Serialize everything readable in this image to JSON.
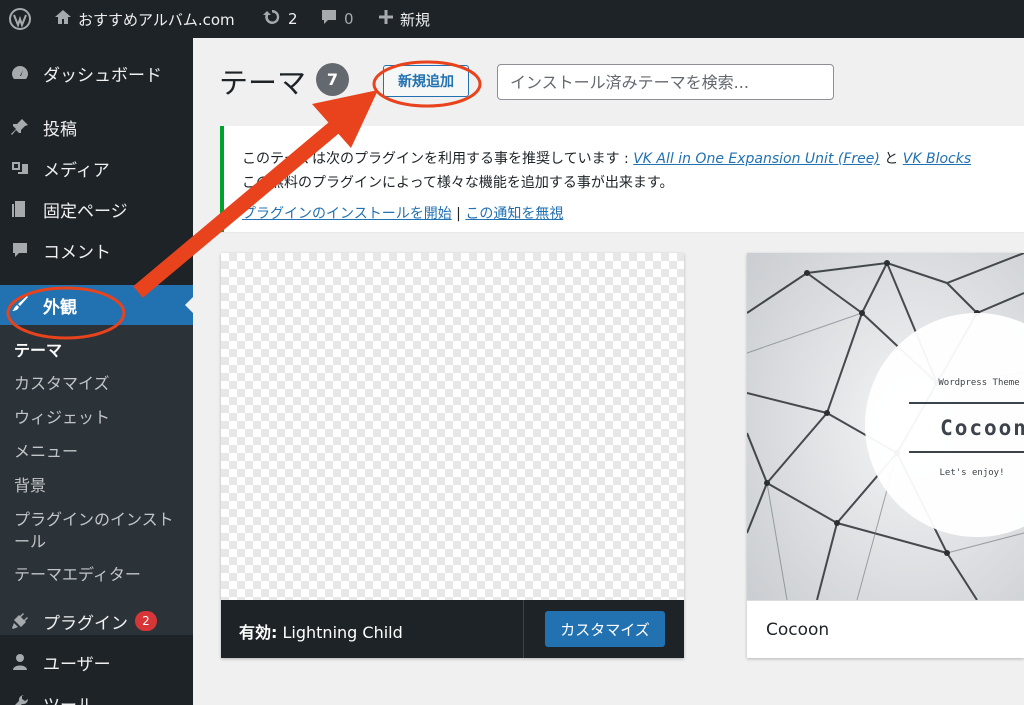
{
  "adminbar": {
    "site_name": "おすすめアルバム.com",
    "updates_count": "2",
    "comments_count": "0",
    "new_label": "新規"
  },
  "sidebar": {
    "dashboard": "ダッシュボード",
    "posts": "投稿",
    "media": "メディア",
    "pages": "固定ページ",
    "comments": "コメント",
    "appearance": "外観",
    "submenu": [
      "テーマ",
      "カスタマイズ",
      "ウィジェット",
      "メニュー",
      "背景",
      "プラグインのインストール",
      "テーマエディター"
    ],
    "plugins": "プラグイン",
    "plugins_badge": "2",
    "users": "ユーザー",
    "tools": "ツール"
  },
  "main": {
    "title": "テーマ",
    "count": "7",
    "add_new": "新規追加",
    "search_placeholder": "インストール済みテーマを検索..."
  },
  "notice": {
    "line1_prefix": "このテーマは次のプラグインを利用する事を推奨しています : ",
    "link_vk_exunit": "VK All in One Expansion Unit (Free)",
    "and": " と ",
    "link_vk_blocks": "VK Blocks",
    "line2": "この無料のプラグインによって様々な機能を追加する事が出来ます。",
    "link_install": "プラグインのインストールを開始",
    "sep": " | ",
    "link_dismiss": "この通知を無視"
  },
  "themes": [
    {
      "active_label": "有効:",
      "name": "Lightning Child",
      "customize": "カスタマイズ"
    },
    {
      "name": "Cocoon",
      "shot_tagline": "Wordpress Theme",
      "shot_title": "Cocoon",
      "shot_sub": "Let's enjoy!"
    }
  ],
  "colors": {
    "admin_dark": "#1d2327",
    "accent_blue": "#2271b1",
    "notice_green": "#00a32a",
    "annotation_red": "#e8431c"
  }
}
